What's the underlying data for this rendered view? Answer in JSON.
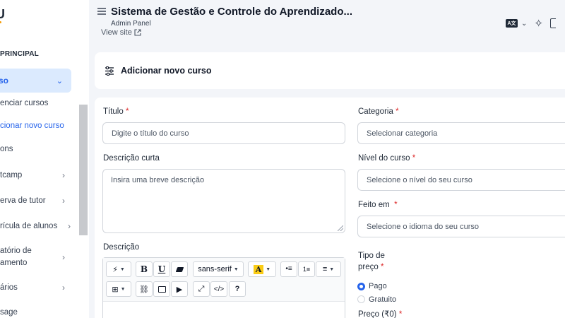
{
  "sidebar": {
    "logo": "U",
    "section": "PRINCIPAL",
    "active_item": "so",
    "subitems": [
      "enciar cursos",
      "cionar novo curso",
      "ons"
    ],
    "items": [
      {
        "label": "tcamp"
      },
      {
        "label": "erva de tutor"
      },
      {
        "label": "rícula de alunos"
      },
      {
        "label": "atório de",
        "label2": "amento"
      },
      {
        "label": "ários"
      },
      {
        "label": "sage"
      }
    ]
  },
  "header": {
    "title": "Sistema de Gestão e Controle do Aprendizado...",
    "subtitle": "Admin Panel",
    "view_site": "View site",
    "lang_icon_text": "A文"
  },
  "card": {
    "title": "Adicionar novo curso"
  },
  "form": {
    "titulo": {
      "label": "Título",
      "placeholder": "Digite o título do curso"
    },
    "descricao_curta": {
      "label": "Descrição curta",
      "placeholder": "Insira uma breve descrição"
    },
    "descricao": {
      "label": "Descrição"
    },
    "categoria": {
      "label": "Categoria",
      "placeholder": "Selecionar categoria"
    },
    "nivel": {
      "label": "Nível do curso",
      "placeholder": "Selecione o nível do seu curso"
    },
    "feito_em": {
      "label": "Feito em",
      "placeholder": "Selecione o idioma do seu curso"
    },
    "tipo_preco": {
      "label_line1": "Tipo de",
      "label_line2": "preço",
      "options": [
        "Pago",
        "Gratuito"
      ],
      "selected": "Pago"
    },
    "preco": {
      "label": "Preço (₹0)"
    }
  },
  "editor": {
    "font": "sans-serif"
  },
  "colors": {
    "accent": "#2563eb",
    "required": "#dc2626",
    "active_bg": "#dbeafe"
  }
}
